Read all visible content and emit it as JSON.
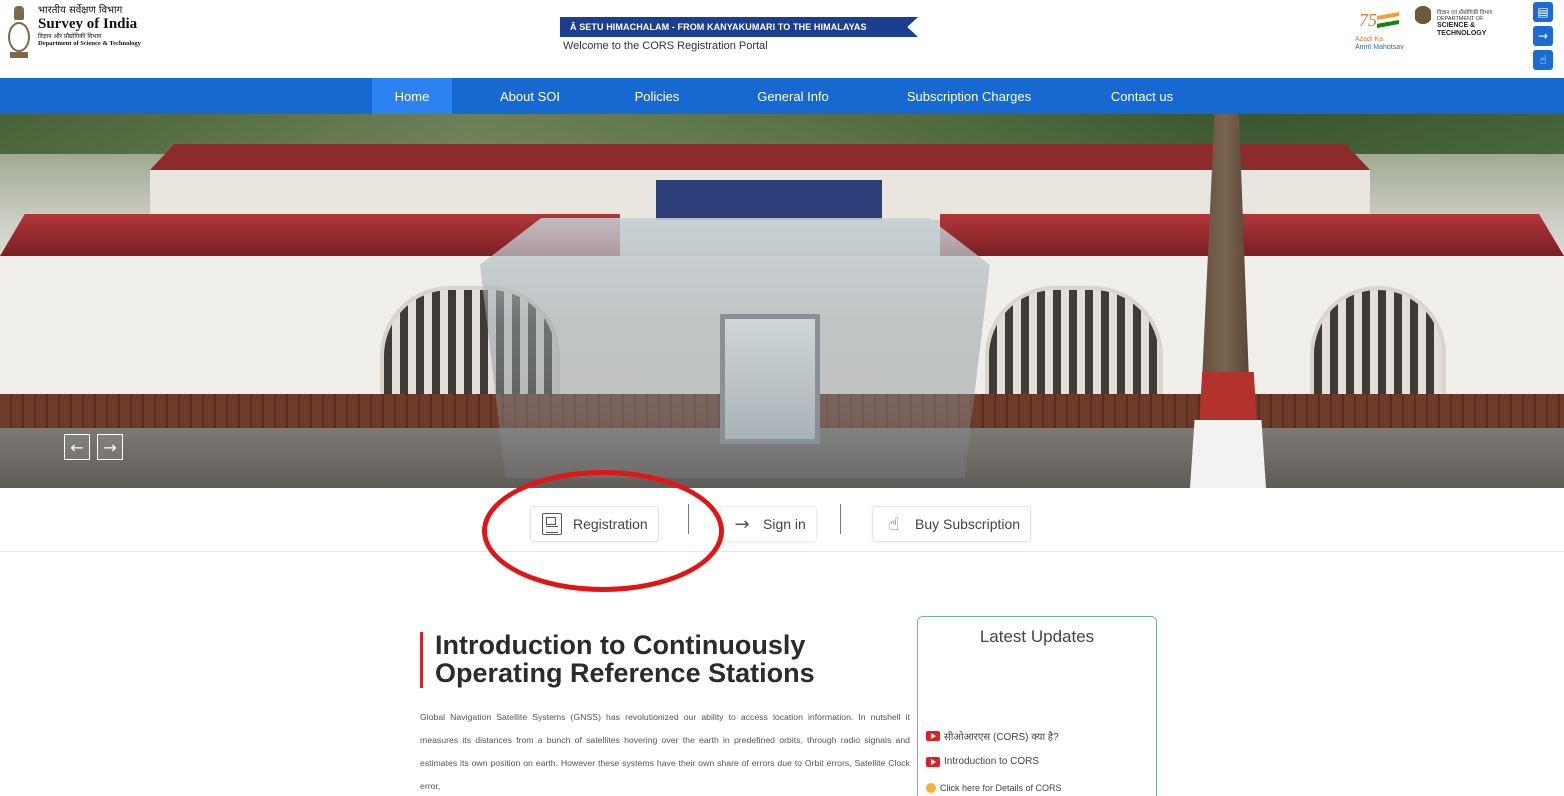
{
  "header": {
    "org_hindi": "भारतीय सर्वेक्षण विभाग",
    "org_name": "Survey of India",
    "org_dept_hindi": "विज्ञान और प्रौद्योगिकी विभाग",
    "org_dept": "Department of Science & Technology",
    "banner": "Ā SETU HIMACHALAM - FROM KANYAKUMARI TO THE HIMALAYAS",
    "welcome": "Welcome to the CORS Registration Portal",
    "azadi_line1": "Azadi Ka",
    "azadi_line2": "Amrit Mahotsav",
    "dst_line1": "विज्ञान एवं प्रौद्योगिकी विभाग",
    "dst_line2": "DEPARTMENT OF",
    "dst_line3": "SCIENCE & TECHNOLOGY",
    "seventy": "75"
  },
  "side_icons": [
    "clipboard-icon",
    "arrow-right-icon",
    "subscription-icon"
  ],
  "nav": {
    "items": [
      {
        "label": "Home",
        "active": true
      },
      {
        "label": "About SOI",
        "active": false
      },
      {
        "label": "Policies",
        "active": false
      },
      {
        "label": "General Info",
        "active": false
      },
      {
        "label": "Subscription Charges",
        "active": false
      },
      {
        "label": "Contact us",
        "active": false
      }
    ]
  },
  "slider": {
    "prev": "←",
    "next": "→"
  },
  "actions": {
    "registration": "Registration",
    "signin": "Sign in",
    "buy": "Buy Subscription",
    "signin_icon": "→",
    "buy_icon": "☝"
  },
  "intro": {
    "title_line1": "Introduction to Continuously",
    "title_line2": "Operating Reference Stations",
    "body": "Global Navigation Satellite Systems (GNSS) has revolutionized our ability to access location information. In nutshell it measures its distances from a bunch of satellites hovering over the earth in predefined orbits, through radio signals and estimates its own position on earth. However these systems have their own share of errors due to Orbit errors, Satellite Clock error,"
  },
  "updates": {
    "title": "Latest Updates",
    "items": [
      {
        "text": "सीओआरएस (CORS) क्या है?",
        "icon": "youtube-icon"
      },
      {
        "text": "Introduction to CORS",
        "icon": "youtube-icon"
      },
      {
        "text": "Click here for Details of CORS",
        "icon": "hand-pointer-icon"
      }
    ]
  },
  "colors": {
    "nav_bg": "#1669d1",
    "nav_active": "#2b82f0",
    "banner_bg": "#1b3f8f",
    "accent_red": "#e01515",
    "title_bar": "#dd2222"
  }
}
